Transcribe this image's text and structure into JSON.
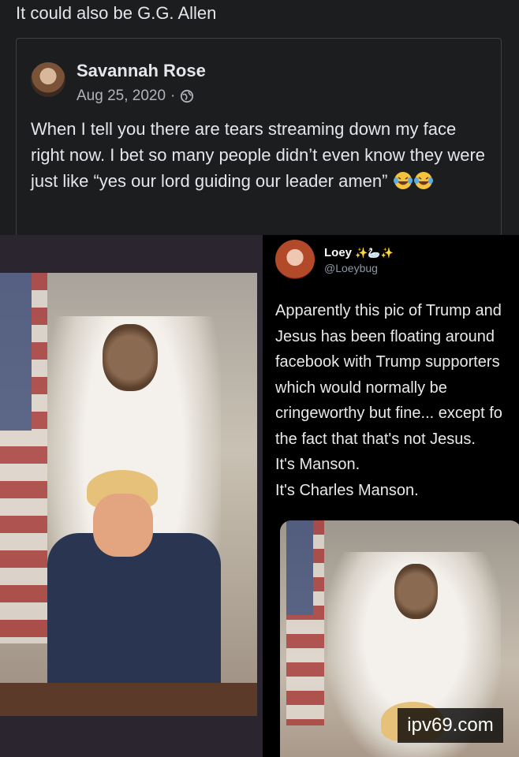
{
  "comment": {
    "text": "It could also be G.G. Allen"
  },
  "shared_post": {
    "author": "Savannah Rose",
    "date": "Aug 25, 2020",
    "separator": "·",
    "privacy_icon": "globe-icon",
    "body": "When I tell you there are tears streaming down my face right now. I bet so many people didn’t even know they were just like “yes our lord guiding our leader amen”",
    "emojis": [
      "laughing-crying-emoji",
      "laughing-crying-emoji"
    ]
  },
  "tweet": {
    "name": "Loey",
    "name_decoration": "✨🦢✨",
    "handle": "@Loeybug",
    "lines": [
      "Apparently this pic of Trump and",
      "Jesus has been floating around",
      "facebook with Trump supporters",
      "which would normally be",
      "cringeworthy but fine... except fo",
      "the fact that that's not Jesus.",
      "It's Manson.",
      "It's Charles Manson."
    ]
  },
  "watermark": {
    "text": "ipv69.com"
  }
}
